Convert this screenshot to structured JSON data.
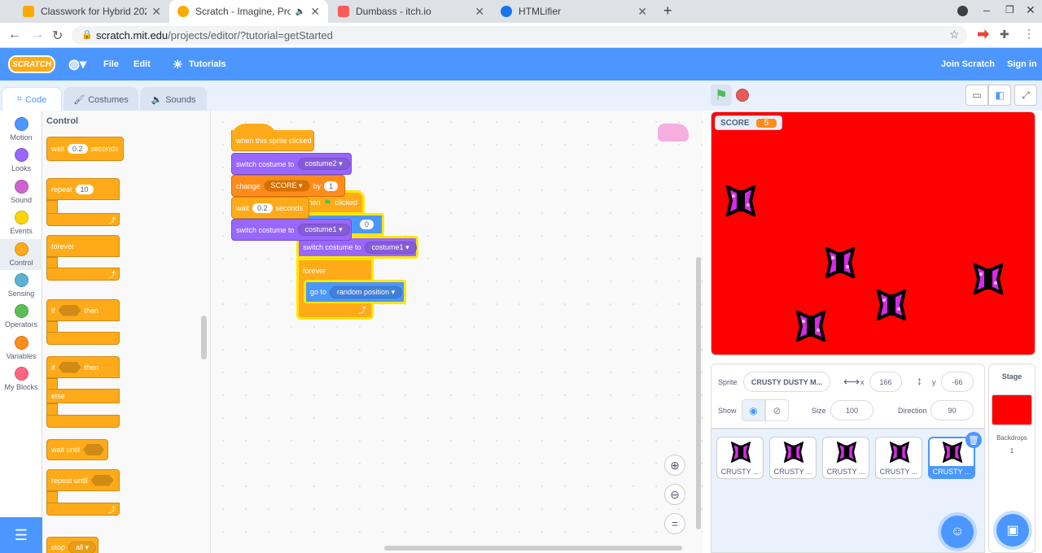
{
  "browser": {
    "tabs": [
      {
        "title": "Classwork for Hybrid 2021 Mrs. F",
        "color": "#f9ab00"
      },
      {
        "title": "Scratch - Imagine, Program, Share",
        "color": "#f9ab00"
      },
      {
        "title": "Dumbass - itch.io",
        "color": "#fa5c5c"
      },
      {
        "title": "HTMLifier",
        "color": "#1a73e8"
      }
    ],
    "new_tab": "+",
    "url_host": "scratch.mit.edu",
    "url_path": "/projects/editor/?tutorial=getStarted"
  },
  "menu": {
    "logo": "SCRATCH",
    "file": "File",
    "edit": "Edit",
    "tutorials": "Tutorials",
    "join": "Join Scratch",
    "signin": "Sign in"
  },
  "editor_tabs": {
    "code": "Code",
    "costumes": "Costumes",
    "sounds": "Sounds"
  },
  "categories": [
    {
      "label": "Motion",
      "color": "#4c97ff"
    },
    {
      "label": "Looks",
      "color": "#9966ff"
    },
    {
      "label": "Sound",
      "color": "#cf63cf"
    },
    {
      "label": "Events",
      "color": "#ffd500"
    },
    {
      "label": "Control",
      "color": "#ffab19"
    },
    {
      "label": "Sensing",
      "color": "#5cb1d6"
    },
    {
      "label": "Operators",
      "color": "#59c059"
    },
    {
      "label": "Variables",
      "color": "#ff8c1a"
    },
    {
      "label": "My Blocks",
      "color": "#ff6680"
    }
  ],
  "palette": {
    "heading": "Control",
    "wait": "wait",
    "wait_val": "0.2",
    "seconds": "seconds",
    "repeat": "repeat",
    "repeat_val": "10",
    "forever": "forever",
    "if": "if",
    "then": "then",
    "else": "else",
    "wait_until": "wait until",
    "repeat_until": "repeat until",
    "stop": "stop",
    "stop_val": "all"
  },
  "script": {
    "hat": "when this sprite clicked",
    "switch_costume": "switch costume to",
    "costume2": "costume2",
    "change": "change",
    "score_var": "SCORE",
    "by": "by",
    "by_val": "1",
    "wait": "wait",
    "wait_val": "0.2",
    "seconds": "seconds",
    "costume1": "costume1",
    "flag_when": "when",
    "flag_clicked": "clicked",
    "set_val": "0",
    "switch2": "switch costume to",
    "costume1b": "costume1",
    "forever": "forever",
    "goto": "go to",
    "random": "random position"
  },
  "stage": {
    "monitor_label": "SCORE",
    "monitor_value": "5",
    "bg_color": "#ff0000"
  },
  "sprite_info": {
    "sprite_label": "Sprite",
    "sprite_name": "CRUSTY DUSTY M...",
    "x_label": "x",
    "x_val": "166",
    "y_label": "y",
    "y_val": "-66",
    "show_label": "Show",
    "size_label": "Size",
    "size_val": "100",
    "direction_label": "Direction",
    "direction_val": "90"
  },
  "sprites": [
    {
      "name": "CRUSTY ..."
    },
    {
      "name": "CRUSTY ..."
    },
    {
      "name": "CRUSTY ..."
    },
    {
      "name": "CRUSTY ..."
    },
    {
      "name": "CRUSTY ..."
    }
  ],
  "stage_panel": {
    "title": "Stage",
    "backdrops_label": "Backdrops",
    "backdrops_count": "1"
  }
}
